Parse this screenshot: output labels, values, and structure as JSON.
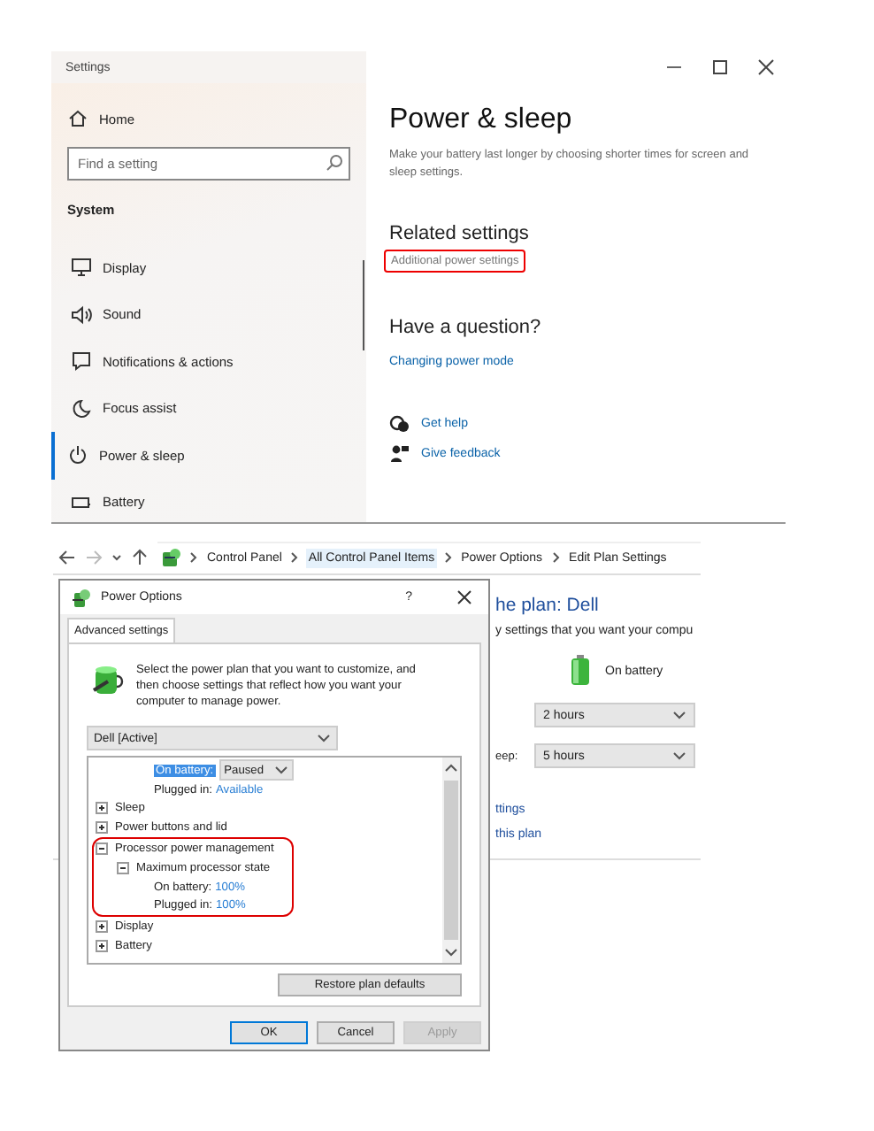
{
  "settings_window": {
    "title": "Settings",
    "sidebar": {
      "home": "Home",
      "search": {
        "placeholder": "Find a setting"
      },
      "section": "System",
      "items": [
        {
          "label": "Display",
          "selected": false
        },
        {
          "label": "Sound",
          "selected": false
        },
        {
          "label": "Notifications & actions",
          "selected": false
        },
        {
          "label": "Focus assist",
          "selected": false
        },
        {
          "label": "Power & sleep",
          "selected": true
        },
        {
          "label": "Battery",
          "selected": false
        }
      ]
    },
    "content": {
      "title": "Power & sleep",
      "description": "Make your battery last longer by choosing shorter times for screen and sleep settings.",
      "related_heading": "Related settings",
      "related_link": {
        "label": "Additional power settings",
        "highlighted": true
      },
      "question_heading": "Have a question?",
      "question_link": "Changing power mode",
      "help_links": [
        "Get help",
        "Give feedback"
      ]
    }
  },
  "control_panel": {
    "breadcrumbs": [
      {
        "label": "Control Panel",
        "selected": false
      },
      {
        "label": "All Control Panel Items",
        "selected": true
      },
      {
        "label": "Power Options",
        "selected": false
      },
      {
        "label": "Edit Plan Settings",
        "selected": false
      }
    ],
    "plan_title": "he plan: Dell",
    "plan_subtitle": "y settings that you want your compu",
    "battery_label": "On battery",
    "rows": [
      {
        "value": "2 hours"
      },
      {
        "label": "eep:",
        "value": "5 hours"
      }
    ],
    "links": [
      "ttings",
      "this plan"
    ]
  },
  "dialog": {
    "title": "Power Options",
    "help": "?",
    "tabs": [
      {
        "label": "Advanced settings",
        "selected": true
      }
    ],
    "intro": "Select the power plan that you want to customize, and then choose settings that reflect how you want your computer to manage power.",
    "plan": "Dell [Active]",
    "tree": [
      {
        "kind": "setting",
        "label": "On battery:",
        "value": "Paused",
        "editing": true,
        "selected": true
      },
      {
        "kind": "setting",
        "label": "Plugged in:",
        "value": "Available",
        "editing": false,
        "selected": false
      },
      {
        "kind": "group",
        "label": "Sleep",
        "expanded": false,
        "highlighted": false,
        "selected": false
      },
      {
        "kind": "group",
        "label": "Power buttons and lid",
        "expanded": false,
        "highlighted": false,
        "selected": false
      },
      {
        "kind": "group",
        "label": "Processor power management",
        "expanded": true,
        "highlighted": true,
        "selected": false,
        "children": [
          {
            "kind": "group",
            "label": "Maximum processor state",
            "expanded": true,
            "highlighted": false,
            "selected": false,
            "children": [
              {
                "kind": "setting",
                "label": "On battery:",
                "value": "100%",
                "editing": false,
                "selected": false
              },
              {
                "kind": "setting",
                "label": "Plugged in:",
                "value": "100%",
                "editing": false,
                "selected": false
              }
            ]
          }
        ]
      },
      {
        "kind": "group",
        "label": "Display",
        "expanded": false,
        "highlighted": false,
        "selected": false
      },
      {
        "kind": "group",
        "label": "Battery",
        "expanded": false,
        "highlighted": false,
        "selected": false
      }
    ],
    "restore": "Restore plan defaults",
    "buttons": [
      {
        "label": "OK",
        "default": true,
        "disabled": false
      },
      {
        "label": "Cancel",
        "default": false,
        "disabled": false
      },
      {
        "label": "Apply",
        "default": false,
        "disabled": true
      }
    ]
  }
}
